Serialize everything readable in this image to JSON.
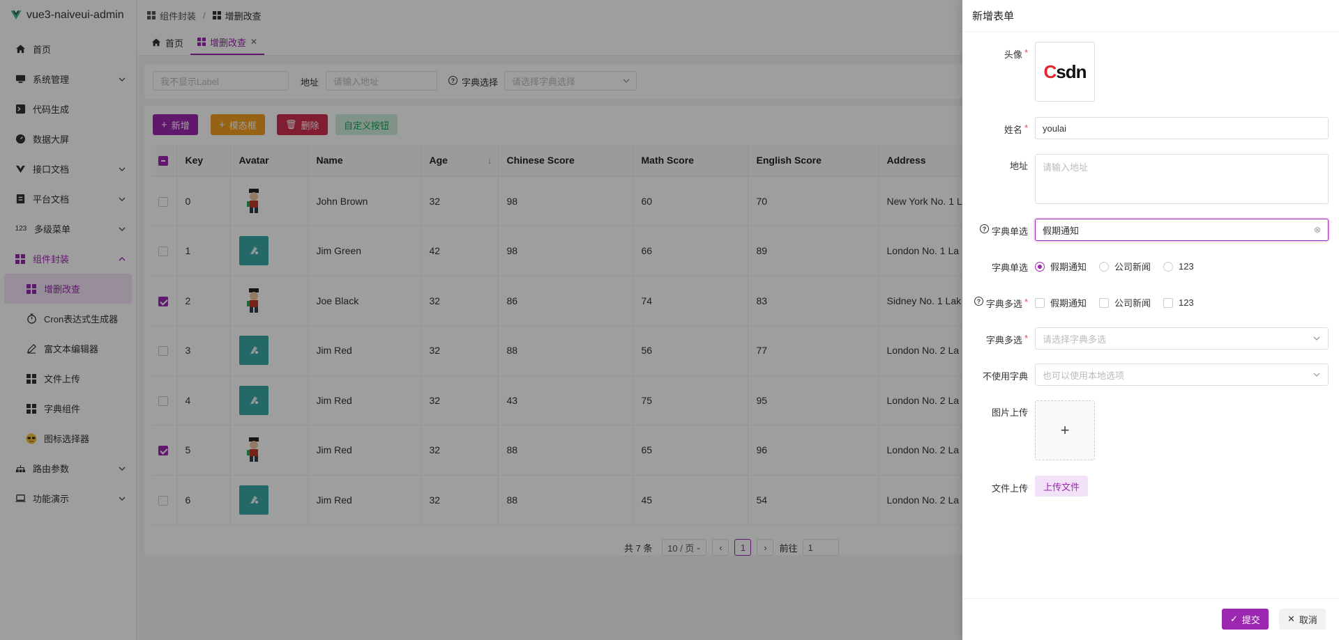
{
  "app": {
    "title": "vue3-naiveui-admin"
  },
  "sidebar": {
    "items": [
      {
        "label": "首页",
        "icon": "home-icon"
      },
      {
        "label": "系统管理",
        "icon": "monitor-icon"
      },
      {
        "label": "代码生成",
        "icon": "terminal-icon"
      },
      {
        "label": "数据大屏",
        "icon": "dashboard-icon"
      },
      {
        "label": "接口文档",
        "icon": "api-icon"
      },
      {
        "label": "平台文档",
        "icon": "document-icon"
      },
      {
        "label": "多级菜单",
        "icon": "numbers-icon",
        "icon_text": "123"
      },
      {
        "label": "组件封装",
        "icon": "grid-icon"
      },
      {
        "label": "增删改查",
        "icon": "grid-icon"
      },
      {
        "label": "Cron表达式生成器",
        "icon": "timer-icon"
      },
      {
        "label": "富文本编辑器",
        "icon": "pen-icon"
      },
      {
        "label": "文件上传",
        "icon": "grid-icon"
      },
      {
        "label": "字典组件",
        "icon": "grid-icon"
      },
      {
        "label": "图标选择器",
        "icon": "sunglasses-emoji-icon"
      },
      {
        "label": "路由参数",
        "icon": "network-icon"
      },
      {
        "label": "功能演示",
        "icon": "laptop-icon"
      }
    ]
  },
  "header": {
    "breadcrumb": [
      "组件封装",
      "增删改查"
    ]
  },
  "tabs": [
    {
      "label": "首页"
    },
    {
      "label": "增删改查"
    }
  ],
  "search": {
    "no_label_placeholder": "我不显示Label",
    "address_label": "地址",
    "address_placeholder": "请输入地址",
    "dict_select_label": "字典选择",
    "dict_select_placeholder": "请选择字典选择"
  },
  "toolbar": {
    "add": "新增",
    "modal": "模态框",
    "delete": "删除",
    "custom": "自定义按钮"
  },
  "table": {
    "columns": [
      "Key",
      "Avatar",
      "Name",
      "Age",
      "Chinese Score",
      "Math Score",
      "English Score",
      "Address"
    ],
    "rows": [
      {
        "key": "0",
        "avatar": "cartoon",
        "name": "John Brown",
        "age": "32",
        "chinese": "98",
        "math": "60",
        "english": "70",
        "address": "New York No. 1 L",
        "checked": false
      },
      {
        "key": "1",
        "avatar": "teal",
        "name": "Jim Green",
        "age": "42",
        "chinese": "98",
        "math": "66",
        "english": "89",
        "address": "London No. 1 La",
        "checked": false
      },
      {
        "key": "2",
        "avatar": "cartoon",
        "name": "Joe Black",
        "age": "32",
        "chinese": "86",
        "math": "74",
        "english": "83",
        "address": "Sidney No. 1 Lak",
        "checked": true
      },
      {
        "key": "3",
        "avatar": "teal",
        "name": "Jim Red",
        "age": "32",
        "chinese": "88",
        "math": "56",
        "english": "77",
        "address": "London No. 2 La",
        "checked": false
      },
      {
        "key": "4",
        "avatar": "teal",
        "name": "Jim Red",
        "age": "32",
        "chinese": "43",
        "math": "75",
        "english": "95",
        "address": "London No. 2 La",
        "checked": false
      },
      {
        "key": "5",
        "avatar": "cartoon",
        "name": "Jim Red",
        "age": "32",
        "chinese": "88",
        "math": "65",
        "english": "96",
        "address": "London No. 2 La",
        "checked": true
      },
      {
        "key": "6",
        "avatar": "teal",
        "name": "Jim Red",
        "age": "32",
        "chinese": "88",
        "math": "45",
        "english": "54",
        "address": "London No. 2 La",
        "checked": false
      }
    ]
  },
  "pagination": {
    "total": "共 7 条",
    "page_size": "10 / 页",
    "current": "1",
    "goto_label": "前往",
    "goto_value": "1"
  },
  "drawer": {
    "title": "新增表单",
    "avatar_label": "头像",
    "avatar_logo": "Csdn",
    "name_label": "姓名",
    "name_value": "youlai",
    "address_label": "地址",
    "address_placeholder": "请输入地址",
    "dict_single_select_label": "字典单选",
    "dict_single_select_value": "假期通知",
    "dict_radio_label": "字典单选",
    "dict_radio_options": [
      "假期通知",
      "公司新闻",
      "123"
    ],
    "dict_checkbox_label": "字典多选",
    "dict_checkbox_options": [
      "假期通知",
      "公司新闻",
      "123"
    ],
    "dict_multi_label": "字典多选",
    "dict_multi_placeholder": "请选择字典多选",
    "no_dict_label": "不使用字典",
    "no_dict_placeholder": "也可以使用本地选项",
    "image_upload_label": "图片上传",
    "file_upload_label": "文件上传",
    "file_upload_button": "上传文件",
    "submit": "提交",
    "cancel": "取消"
  },
  "colors": {
    "primary": "#9c27b0",
    "warning": "#f0a020",
    "danger": "#d03050",
    "success": "#18a058"
  }
}
